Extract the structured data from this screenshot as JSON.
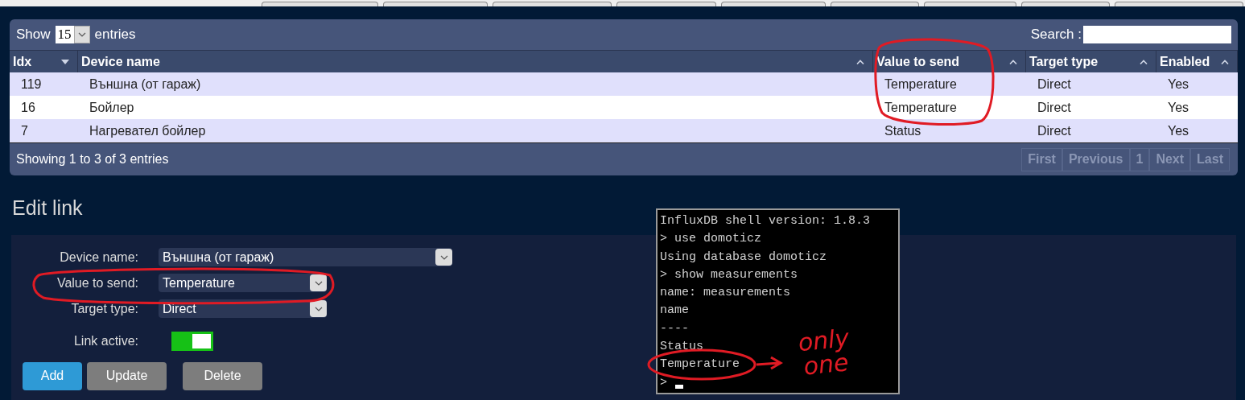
{
  "table_controls": {
    "show_label": "Show",
    "page_size": "15",
    "entries_label": "entries",
    "search_label": "Search :"
  },
  "table": {
    "columns": [
      {
        "label": "Idx",
        "sorted": true
      },
      {
        "label": "Device name",
        "sorted": false
      },
      {
        "label": "Value to send",
        "sorted": false
      },
      {
        "label": "Target type",
        "sorted": false
      },
      {
        "label": "Enabled",
        "sorted": false
      }
    ],
    "rows": [
      [
        "119",
        "Външна (от гараж)",
        "Temperature",
        "Direct",
        "Yes"
      ],
      [
        "16",
        "Бойлер",
        "Temperature",
        "Direct",
        "Yes"
      ],
      [
        "7",
        "Нагревател бойлер",
        "Status",
        "Direct",
        "Yes"
      ]
    ]
  },
  "footer": {
    "info": "Showing 1 to 3 of 3 entries",
    "pagination": [
      {
        "label": "First",
        "disabled": true
      },
      {
        "label": "Previous",
        "disabled": true
      },
      {
        "label": "1",
        "disabled": true
      },
      {
        "label": "Next",
        "disabled": true
      },
      {
        "label": "Last",
        "disabled": true
      }
    ]
  },
  "edit_link": {
    "title": "Edit link",
    "fields": [
      {
        "kind": "select",
        "label": "Device name:",
        "value": "Външна (от гараж)"
      },
      {
        "kind": "select",
        "label": "Value to send:",
        "value": "Temperature"
      },
      {
        "kind": "select",
        "label": "Target type:",
        "value": "Direct"
      },
      {
        "kind": "toggle",
        "label": "Link active:",
        "on": true
      }
    ],
    "buttons": [
      {
        "label": "Add",
        "kind": "primary"
      },
      {
        "label": "Update",
        "kind": "secondary"
      },
      {
        "label": "Delete",
        "kind": "secondary"
      }
    ]
  },
  "terminal": {
    "lines": [
      "InfluxDB shell version: 1.8.3",
      "> use domoticz",
      "Using database domoticz",
      "> show measurements",
      "name: measurements",
      "name",
      "----",
      "Status",
      "Temperature",
      ">"
    ]
  },
  "annotation": {
    "note": "only one"
  }
}
